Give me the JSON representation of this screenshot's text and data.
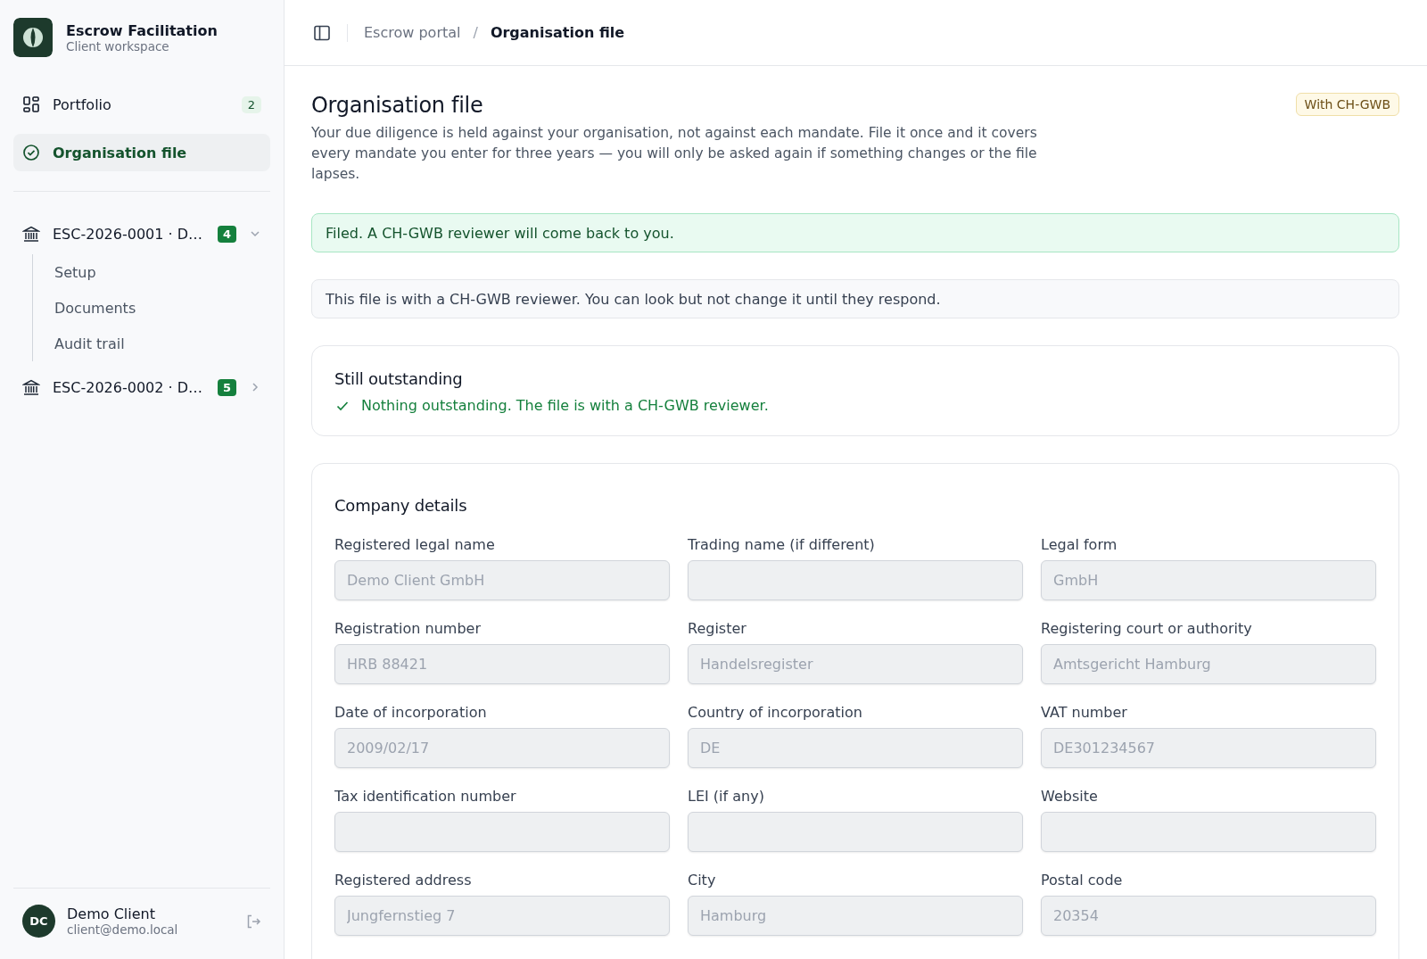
{
  "brand": {
    "title": "Escrow Facilitation",
    "subtitle": "Client workspace"
  },
  "nav": [
    {
      "label": "Portfolio",
      "kind": "grid",
      "count": "2",
      "selected": false
    },
    {
      "label": "Organisation file",
      "kind": "check",
      "selected": true
    }
  ],
  "mandates": [
    {
      "label": "ESC-2026-0001 · D…",
      "count": "4",
      "expanded": true,
      "children": [
        {
          "label": "Setup"
        },
        {
          "label": "Documents"
        },
        {
          "label": "Audit trail"
        }
      ]
    },
    {
      "label": "ESC-2026-0002 · D…",
      "count": "5",
      "expanded": false
    }
  ],
  "user": {
    "initials": "DC",
    "name": "Demo Client",
    "email": "client@demo.local"
  },
  "breadcrumb_separator": "/",
  "breadcrumb": [
    {
      "label": "Escrow portal",
      "current": false
    },
    {
      "label": "Organisation file",
      "current": true
    }
  ],
  "page": {
    "title": "Organisation file",
    "status": "With CH-GWB",
    "description": "Your due diligence is held against your organisation, not against each mandate. File it once and it covers every mandate you enter for three years — you will only be asked again if something changes or the file lapses."
  },
  "alerts": [
    {
      "kind": "success",
      "text": "Filed. A CH-GWB reviewer will come back to you."
    },
    {
      "kind": "info",
      "text": "This file is with a CH-GWB reviewer. You can look but not change it until they respond."
    }
  ],
  "outstanding": {
    "title": "Still outstanding",
    "message": "Nothing outstanding. The file is with a CH-GWB reviewer."
  },
  "company": {
    "title": "Company details",
    "fields": [
      {
        "label": "Registered legal name",
        "value": "Demo Client GmbH",
        "disabled": true
      },
      {
        "label": "Trading name (if different)",
        "disabled": true
      },
      {
        "label": "Legal form",
        "value": "GmbH",
        "disabled": true
      },
      {
        "label": "Registration number",
        "value": "HRB 88421",
        "disabled": true
      },
      {
        "label": "Register",
        "value": "Handelsregister",
        "disabled": true
      },
      {
        "label": "Registering court or authority",
        "value": "Amtsgericht Hamburg",
        "disabled": true
      },
      {
        "label": "Date of incorporation",
        "value": "2009/02/17",
        "disabled": true
      },
      {
        "label": "Country of incorporation",
        "value": "DE",
        "disabled": true
      },
      {
        "label": "VAT number",
        "value": "DE301234567",
        "disabled": true
      },
      {
        "label": "Tax identification number",
        "disabled": true
      },
      {
        "label": "LEI (if any)",
        "disabled": true
      },
      {
        "label": "Website",
        "disabled": true
      },
      {
        "label": "Registered address",
        "value": "Jungfernstieg 7",
        "disabled": true
      },
      {
        "label": "City",
        "value": "Hamburg",
        "disabled": true
      },
      {
        "label": "Postal code",
        "value": "20354",
        "disabled": true
      }
    ]
  }
}
